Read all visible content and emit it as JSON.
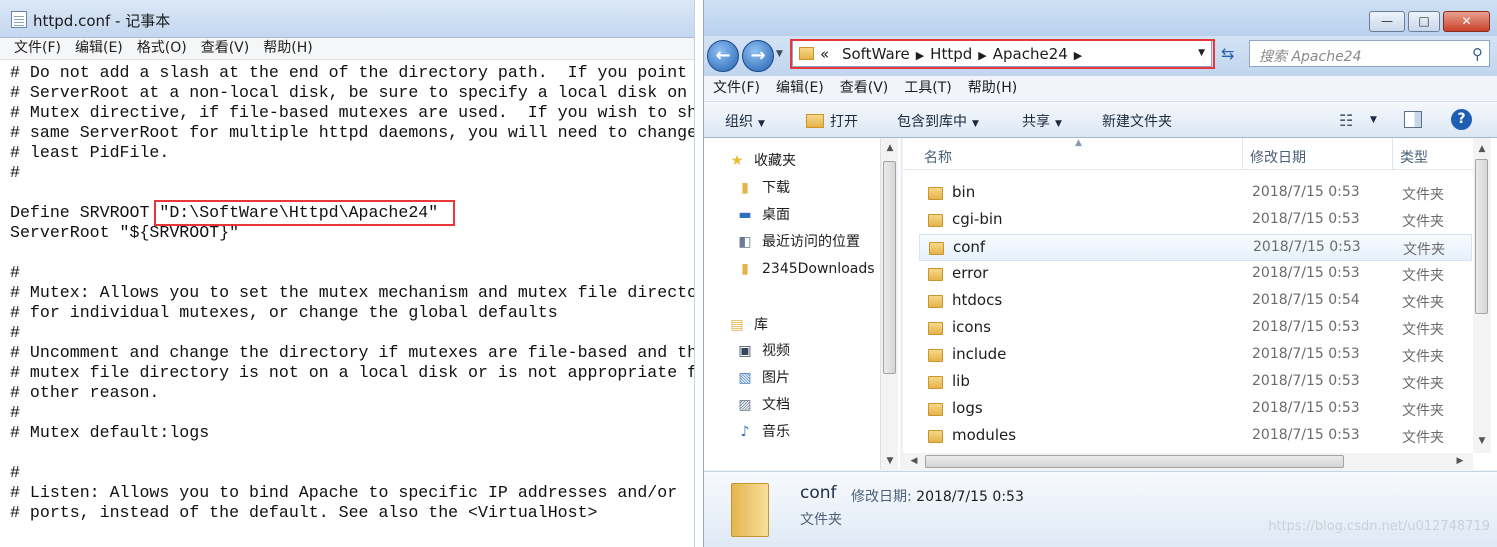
{
  "notepad": {
    "title": "httpd.conf - 记事本",
    "menu": [
      "文件(F)",
      "编辑(E)",
      "格式(O)",
      "查看(V)",
      "帮助(H)"
    ],
    "lines": [
      "# Do not add a slash at the end of the directory path.  If you point",
      "# ServerRoot at a non-local disk, be sure to specify a local disk on",
      "# Mutex directive, if file-based mutexes are used.  If you wish to sh",
      "# same ServerRoot for multiple httpd daemons, you will need to change",
      "# least PidFile.",
      "#",
      "",
      "Define SRVROOT \"D:\\SoftWare\\Httpd\\Apache24\"",
      "ServerRoot \"${SRVROOT}\"",
      "",
      "#",
      "# Mutex: Allows you to set the mutex mechanism and mutex file directo",
      "# for individual mutexes, or change the global defaults",
      "#",
      "# Uncomment and change the directory if mutexes are file-based and th",
      "# mutex file directory is not on a local disk or is not appropriate f",
      "# other reason.",
      "#",
      "# Mutex default:logs",
      "",
      "#",
      "# Listen: Allows you to bind Apache to specific IP addresses and/or",
      "# ports, instead of the default. See also the <VirtualHost>"
    ]
  },
  "explorer": {
    "window_buttons": [
      "—",
      "□",
      "✕"
    ],
    "back_icon": "back-arrow-icon",
    "forward_icon": "forward-arrow-icon",
    "breadcrumb": [
      "«",
      "SoftWare",
      "Httpd",
      "Apache24"
    ],
    "search_placeholder": "搜索 Apache24",
    "menu": [
      "文件(F)",
      "编辑(E)",
      "查看(V)",
      "工具(T)",
      "帮助(H)"
    ],
    "toolbar": {
      "organize": "组织",
      "open": "打开",
      "include_in_library": "包含到库中",
      "share": "共享",
      "new_folder": "新建文件夹"
    },
    "nav": {
      "favorites": "收藏夹",
      "downloads": "下载",
      "desktop": "桌面",
      "recent": "最近访问的位置",
      "downloads2345": "2345Downloads",
      "libraries": "库",
      "videos": "视频",
      "pictures": "图片",
      "documents": "文档",
      "music": "音乐"
    },
    "columns": [
      "名称",
      "修改日期",
      "类型"
    ],
    "files": [
      {
        "name": "bin",
        "date": "2018/7/15 0:53",
        "type": "文件夹"
      },
      {
        "name": "cgi-bin",
        "date": "2018/7/15 0:53",
        "type": "文件夹"
      },
      {
        "name": "conf",
        "date": "2018/7/15 0:53",
        "type": "文件夹"
      },
      {
        "name": "error",
        "date": "2018/7/15 0:53",
        "type": "文件夹"
      },
      {
        "name": "htdocs",
        "date": "2018/7/15 0:54",
        "type": "文件夹"
      },
      {
        "name": "icons",
        "date": "2018/7/15 0:53",
        "type": "文件夹"
      },
      {
        "name": "include",
        "date": "2018/7/15 0:53",
        "type": "文件夹"
      },
      {
        "name": "lib",
        "date": "2018/7/15 0:53",
        "type": "文件夹"
      },
      {
        "name": "logs",
        "date": "2018/7/15 0:53",
        "type": "文件夹"
      },
      {
        "name": "modules",
        "date": "2018/7/15 0:53",
        "type": "文件夹"
      }
    ],
    "selected_file": "conf",
    "details": {
      "name": "conf",
      "modified_label": "修改日期:",
      "modified_value": "2018/7/15 0:53",
      "type": "文件夹"
    },
    "watermark": "https://blog.csdn.net/u012748719"
  },
  "colors": {
    "highlight_red": "#e8363b",
    "accent_blue": "#2461b0",
    "folder_yellow": "#e5b34a"
  }
}
